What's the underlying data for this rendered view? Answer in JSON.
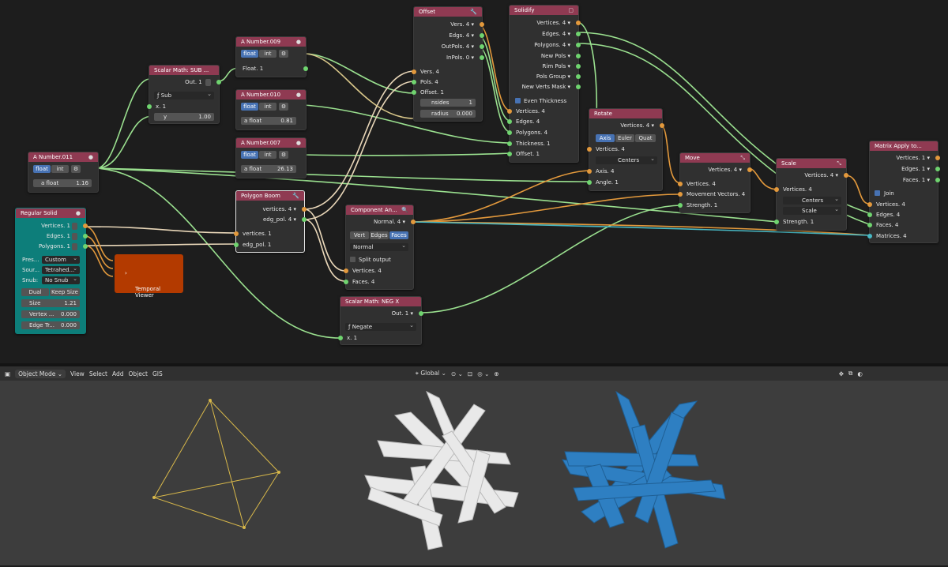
{
  "nodes": {
    "scalar_sub": {
      "title": "Scalar Math: SUB ...",
      "out": "Out. 1",
      "mode": "Sub",
      "x": "x. 1",
      "y_label": "y",
      "y_value": "1.00"
    },
    "num009": {
      "title": "A Number.009",
      "float": "float",
      "int": "int",
      "out": "Float. 1"
    },
    "num010": {
      "title": "A Number.010",
      "float": "float",
      "int": "int",
      "label": "a float",
      "value": "0.81"
    },
    "num007": {
      "title": "A Number.007",
      "float": "float",
      "int": "int",
      "label": "a float",
      "value": "26.13"
    },
    "num011": {
      "title": "A Number.011",
      "float": "float",
      "int": "int",
      "label": "a float",
      "value": "1.16"
    },
    "offset": {
      "title": "Offset",
      "outs": [
        "Vers. 4",
        "Edgs. 4",
        "OutPols. 4",
        "InPols. 0"
      ],
      "ins": [
        "Vers. 4",
        "Pols. 4",
        "Offset. 1"
      ],
      "nsides_label": "nsides",
      "nsides_value": "1",
      "radius_label": "radius",
      "radius_value": "0.000"
    },
    "solidify": {
      "title": "Solidify",
      "outs": [
        "Vertices. 4",
        "Edges. 4",
        "Polygons. 4",
        "New Pols",
        "Rim Pols",
        "Pols Group",
        "New Verts Mask"
      ],
      "even": "Even Thickness",
      "ins": [
        "Vertices. 4",
        "Edges. 4",
        "Polygons. 4",
        "Thickness. 1",
        "Offset. 1"
      ]
    },
    "rotate": {
      "title": "Rotate",
      "out": "Vertices. 4",
      "tabs": [
        "Axis",
        "Euler",
        "Quat"
      ],
      "centers": "Centers",
      "ins": [
        "Vertices. 4",
        "Axis. 4",
        "Angle. 1"
      ]
    },
    "move": {
      "title": "Move",
      "out": "Vertices. 4",
      "ins": [
        "Vertices. 4",
        "Movement Vectors. 4",
        "Strength. 1"
      ]
    },
    "scale": {
      "title": "Scale",
      "out": "Vertices. 4",
      "in_vertices": "Vertices. 4",
      "centers": "Centers",
      "scale": "Scale",
      "in_strength": "Strength. 1"
    },
    "matrix": {
      "title": "Matrix Apply to...",
      "outs": [
        "Vertices. 1",
        "Edges. 1",
        "Faces. 1"
      ],
      "join": "Join",
      "ins": [
        "Vertices. 4",
        "Edges. 4",
        "Faces. 4",
        "Matrices. 4"
      ]
    },
    "polyboom": {
      "title": "Polygon Boom",
      "outs": [
        "vertices. 4",
        "edg_pol. 4"
      ],
      "ins": [
        "vertices. 1",
        "edg_pol. 1"
      ]
    },
    "component": {
      "title": "Component An...",
      "out": "Normal. 4",
      "tabs": [
        "Vert",
        "Edges",
        "Faces"
      ],
      "mode": "Normal",
      "split": "Split output",
      "ins": [
        "Vertices. 4",
        "Faces. 4"
      ]
    },
    "scalar_neg": {
      "title": "Scalar Math: NEG X",
      "out": "Out. 1",
      "mode": "Negate",
      "x": "x. 1"
    },
    "regular": {
      "title": "Regular Solid",
      "outs": [
        "Vertices. 1",
        "Edges. 1",
        "Polygons. 1"
      ],
      "preset_label": "Pres...",
      "preset": "Custom",
      "source_label": "Sour...",
      "source": "Tetrahed...",
      "snub_label": "Snub:",
      "snub": "No Snub",
      "dual": "Dual",
      "keep": "Keep Size",
      "size_label": "Size",
      "size": "1.21",
      "vertex_label": "Vertex ...",
      "vertex": "0.000",
      "edge_label": "Edge Tr...",
      "edge": "0.000"
    },
    "viewer": {
      "title": "Temporal Viewer"
    }
  },
  "header": {
    "mode": "Object Mode",
    "menu": [
      "View",
      "Select",
      "Add",
      "Object",
      "GIS"
    ],
    "orientation": "Global"
  },
  "colors": {
    "node_header": "#8f3a52",
    "vertex_socket": "#e3993c",
    "number_socket": "#6fd46f",
    "matrix_socket": "#47b8c4",
    "viewer": "#b33a00",
    "regular_solid": "#0d7e7a",
    "wire_mesh": "#e6cf4a",
    "solid_white": "#e8e8e8",
    "solid_blue": "#2e7fc2"
  }
}
